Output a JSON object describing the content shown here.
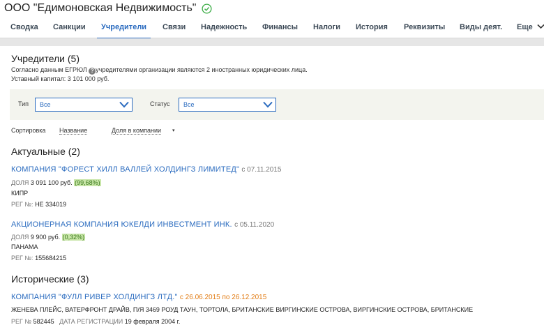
{
  "header": {
    "company_name": "ООО \"Едимоновская Недвижимость\"",
    "status_icon": "check-circle-icon"
  },
  "tabs": [
    {
      "label": "Сводка"
    },
    {
      "label": "Санкции"
    },
    {
      "label": "Учредители",
      "active": true
    },
    {
      "label": "Связи"
    },
    {
      "label": "Надежность"
    },
    {
      "label": "Финансы"
    },
    {
      "label": "Налоги"
    },
    {
      "label": "История"
    },
    {
      "label": "Реквизиты"
    },
    {
      "label": "Виды деят."
    },
    {
      "label": "Еще"
    }
  ],
  "founders": {
    "heading": "Учредители (5)",
    "desc_part1": "Согласно данным ЕГРЮЛ",
    "desc_part2": "учредителями организации являются 2 иностранных юридических лица.",
    "capital": "Уставный капитал: 3 101 000 руб."
  },
  "filters": {
    "type_label": "Тип",
    "type_value": "Все",
    "status_label": "Статус",
    "status_value": "Все"
  },
  "sort": {
    "label": "Сортировка",
    "option_name": "Название",
    "option_share": "Доля в компании",
    "arrow": "▾"
  },
  "current": {
    "heading": "Актуальные (2)",
    "items": [
      {
        "name": "КОМПАНИЯ \"ФОРЕСТ ХИЛЛ ВАЛЛЕЙ ХОЛДИНГЗ ЛИМИТЕД\"",
        "since": "с 07.11.2015",
        "share_label": "ДОЛЯ",
        "share_value": "3 091 100 руб.",
        "share_pct": "(99,68%)",
        "country": "КИПР",
        "reg_label": "РЕГ №:",
        "reg_value": "НЕ 334019"
      },
      {
        "name": "АКЦИОНЕРНАЯ КОМПАНИЯ ЮКЕЛДИ ИНВЕСТМЕНТ ИНК.",
        "since": "с 05.11.2020",
        "share_label": "ДОЛЯ",
        "share_value": "9 900 руб.",
        "share_pct": "(0,32%)",
        "country": "ПАНАМА",
        "reg_label": "РЕГ №:",
        "reg_value": "155684215"
      }
    ]
  },
  "historical": {
    "heading": "Исторические (3)",
    "items": [
      {
        "name": "КОМПАНИЯ \"ФУЛЛ РИВЕР ХОЛДИНГЗ ЛТД.\"",
        "since": "с 26.06.2015 по 26.12.2015",
        "address": "ЖЕНЕВА ПЛЕЙС, ВАТЕРФРОНТ ДРАЙВ, П/Я 3469 РОУД ТАУН, ТОРТОЛА, БРИТАНСКИЕ ВИРГИНСКИЕ ОСТРОВА, ВИРГИНСКИЕ ОСТРОВА, БРИТАНСКИЕ",
        "reg_label": "РЕГ №",
        "reg_value": "582445",
        "date_label": "ДАТА РЕГИСТРАЦИИ",
        "date_value": "19 февраля 2004 г."
      }
    ]
  },
  "colors": {
    "link": "#2a6bbf",
    "active_tab": "#2a6bbf",
    "historical_date": "#e27d16",
    "pct_bg": "#c8e6a8",
    "status_ok": "#3fae49"
  }
}
